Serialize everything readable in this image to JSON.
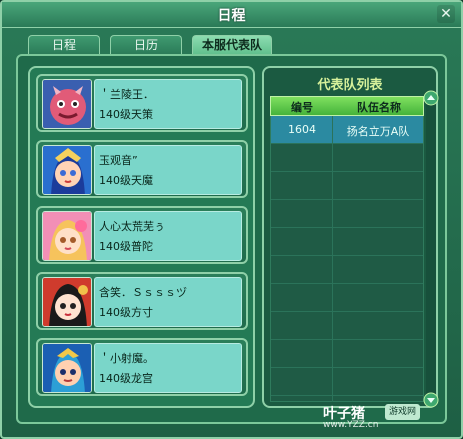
{
  "window": {
    "title": "日程",
    "close_label": "✕",
    "colors": {
      "accent": "#7cc89a",
      "header_green": "#45b33b",
      "selected_row": "#2b8aa1"
    }
  },
  "tabs": [
    {
      "label": "日程"
    },
    {
      "label": "日历"
    },
    {
      "label": "本服代表队"
    }
  ],
  "players": [
    {
      "name": "＇兰陵王．",
      "detail": "140级天策",
      "portrait": "pink-mask-icon"
    },
    {
      "name": "玉观音”",
      "detail": "140级天魔",
      "portrait": "blue-hair-girl-icon"
    },
    {
      "name": "人心太荒芜ぅ",
      "detail": "140级普陀",
      "portrait": "blonde-girl-icon"
    },
    {
      "name": "含笑．Ｓｓｓｓヅ",
      "detail": "140级方寸",
      "portrait": "black-hair-girl-icon"
    },
    {
      "name": "＇小射魔。",
      "detail": "140级龙宫",
      "portrait": "blue-warrior-icon"
    }
  ],
  "team_list": {
    "title": "代表队列表",
    "columns": [
      "编号",
      "队伍名称"
    ],
    "rows": [
      {
        "id": "1604",
        "name": "扬名立万A队"
      }
    ]
  },
  "watermark": {
    "main": "叶子猪",
    "badge": "游戏网",
    "url": "www.YZZ.cn"
  }
}
